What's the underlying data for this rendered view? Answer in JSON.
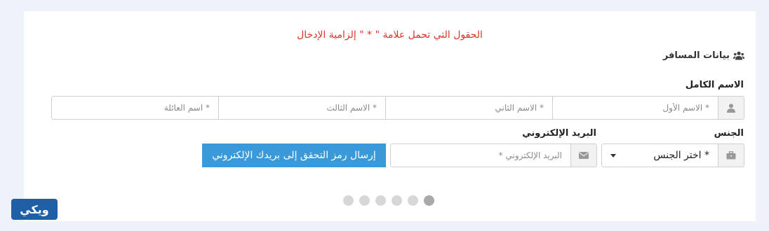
{
  "notice": "الحقول التي تحمل علامة \" * \" إلزامية الإدخال",
  "section": {
    "title": "بيانات المسافر",
    "icon": "users-icon"
  },
  "full_name": {
    "label": "الاسم الكامل",
    "icon": "user-icon",
    "first_placeholder": "* الاسم الأول",
    "second_placeholder": "* الاسم الثاني",
    "third_placeholder": "* الاسم الثالث",
    "family_placeholder": "* اسم العائلة"
  },
  "gender": {
    "label": "الجنس",
    "icon": "briefcase-icon",
    "selected": "* اختر الجنس"
  },
  "email": {
    "label": "البريد الإلكتروني",
    "icon": "envelope-icon",
    "placeholder": "البريد الإلكتروني *"
  },
  "send_button": "إرسال رمز التحقق إلى بريدك الإلكتروني",
  "carousel": {
    "count": 6,
    "active_index": 5
  },
  "logo_text": "ويكي"
}
